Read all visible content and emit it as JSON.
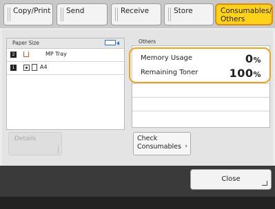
{
  "tabs": [
    {
      "label": "Copy/Print",
      "active": false
    },
    {
      "label": "Send",
      "active": false
    },
    {
      "label": "Receive",
      "active": false
    },
    {
      "label": "Store",
      "active": false
    },
    {
      "label": "Consumables/ Others",
      "active": true
    }
  ],
  "paper": {
    "header": "Paper Size",
    "rows": [
      {
        "index": "2",
        "name": "MP Tray"
      },
      {
        "index": "1",
        "name": "A4"
      }
    ]
  },
  "details_label": "Details",
  "others": {
    "title": "Others",
    "memory_label": "Memory Usage",
    "memory_value": "0",
    "memory_unit": "%",
    "toner_label": "Remaining Toner",
    "toner_value": "100",
    "toner_unit": "%"
  },
  "check_label": "Check Consumables",
  "check_chevron": "›",
  "close_label": "Close",
  "colors": {
    "accent": "#ffd21a",
    "highlight": "#f0a021"
  }
}
